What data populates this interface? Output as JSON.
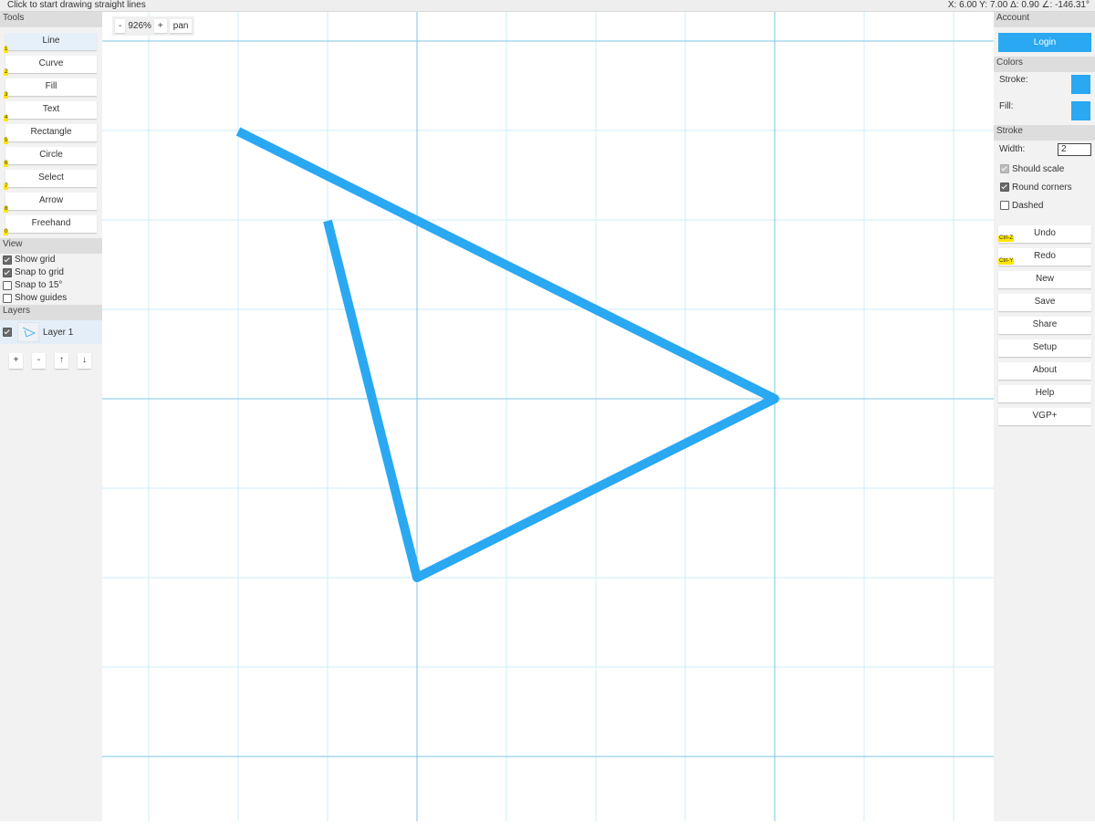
{
  "status": {
    "hint": "Click to start drawing straight lines",
    "coords": "X: 6.00 Y: 7.00 Δ: 0.90 ∠: -146.31°"
  },
  "tools": {
    "header": "Tools",
    "items": [
      {
        "label": "Line",
        "key": "1"
      },
      {
        "label": "Curve",
        "key": "2"
      },
      {
        "label": "Fill",
        "key": "3"
      },
      {
        "label": "Text",
        "key": "4"
      },
      {
        "label": "Rectangle",
        "key": "5"
      },
      {
        "label": "Circle",
        "key": "6"
      },
      {
        "label": "Select",
        "key": "7"
      },
      {
        "label": "Arrow",
        "key": "8"
      },
      {
        "label": "Freehand",
        "key": "0"
      }
    ]
  },
  "view": {
    "header": "View",
    "show_grid": "Show grid",
    "snap_grid": "Snap to grid",
    "snap_15": "Snap to 15°",
    "show_guides": "Show guides"
  },
  "layers": {
    "header": "Layers",
    "layer1": "Layer 1",
    "add": "+",
    "remove": "-",
    "up": "↑",
    "down": "↓"
  },
  "zoom": {
    "minus": "-",
    "level": "926%",
    "plus": "+",
    "pan": "pan"
  },
  "account": {
    "header": "Account",
    "login": "Login"
  },
  "colors": {
    "header": "Colors",
    "stroke_label": "Stroke:",
    "fill_label": "Fill:",
    "stroke_color": "#2aa8f2",
    "fill_color": "#2aa8f2"
  },
  "stroke": {
    "header": "Stroke",
    "width_label": "Width:",
    "width_value": "2",
    "should_scale": "Should scale",
    "round_corners": "Round corners",
    "dashed": "Dashed"
  },
  "actions": {
    "undo": "Undo",
    "undo_key": "Ctrl-Z",
    "redo": "Redo",
    "redo_key": "Ctrl-Y",
    "new": "New",
    "save": "Save",
    "share": "Share",
    "setup": "Setup",
    "about": "About",
    "help": "Help",
    "vgp": "VGP+"
  }
}
